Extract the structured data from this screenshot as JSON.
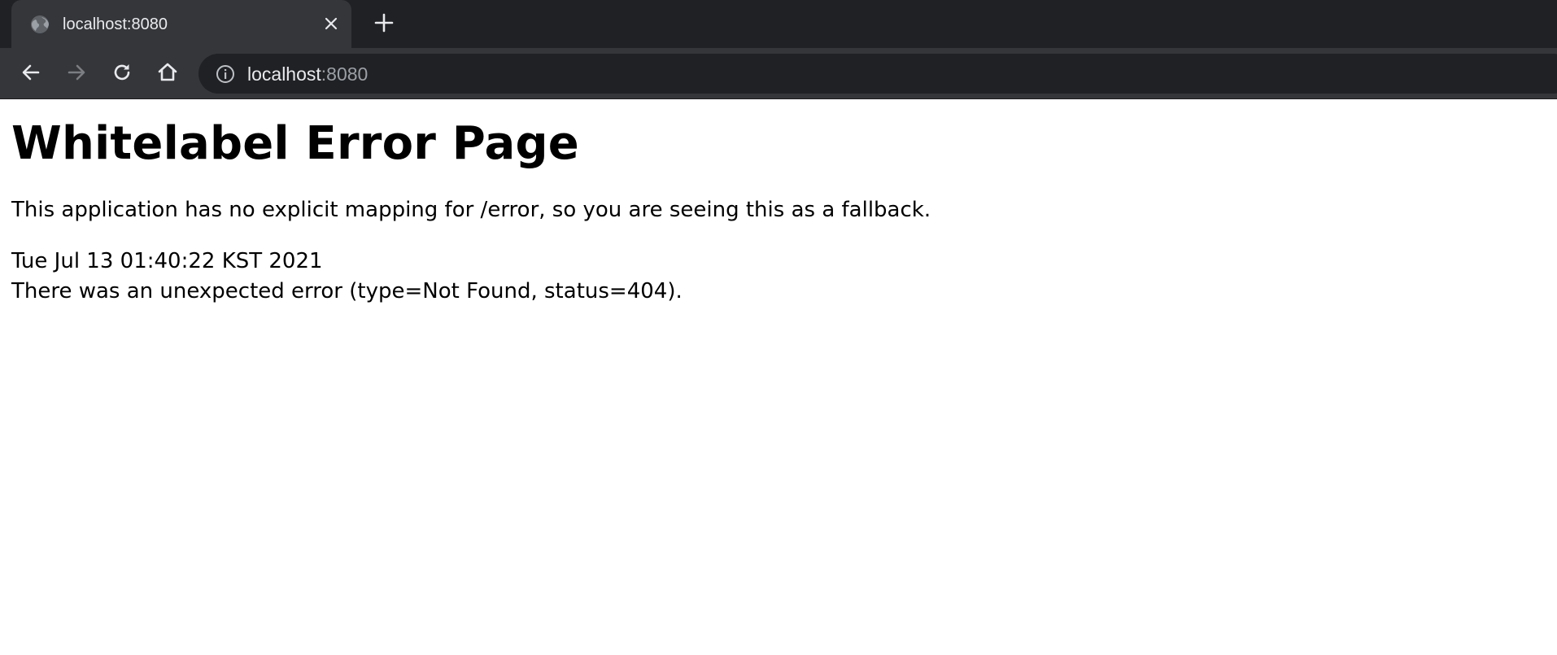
{
  "browser": {
    "tab": {
      "title": "localhost:8080",
      "favicon": "globe-icon"
    },
    "toolbar": {
      "back_icon": "back-arrow-icon",
      "forward_icon": "forward-arrow-icon",
      "reload_icon": "reload-icon",
      "home_icon": "home-icon",
      "address": {
        "host": "localhost",
        "port": ":8080",
        "security_icon": "info-icon"
      }
    },
    "colors": {
      "tabstrip_bg": "#202124",
      "active_tab_bg": "#35363a",
      "omnibox_bg": "#202124",
      "url_host": "#e8eaed",
      "url_port": "#9aa0a6"
    }
  },
  "page": {
    "heading": "Whitelabel Error Page",
    "description": "This application has no explicit mapping for /error, so you are seeing this as a fallback.",
    "timestamp": "Tue Jul 13 01:40:22 KST 2021",
    "error_message": "There was an unexpected error (type=Not Found, status=404)."
  }
}
